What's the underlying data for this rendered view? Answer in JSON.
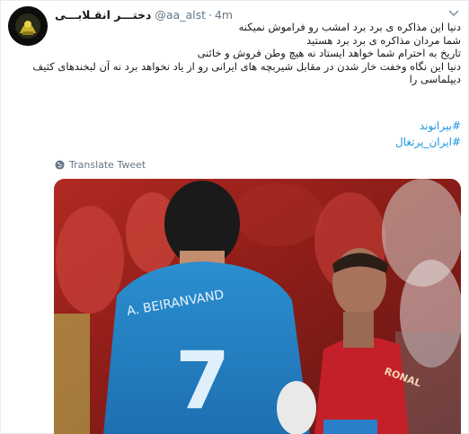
{
  "tweet": {
    "display_name": "دختـــر انقـلابـــی",
    "handle": "@aa_alst",
    "separator": "·",
    "timestamp": "4m",
    "lines": [
      "دنیا این مذاکره ی برد برد امشب رو فراموش نمیکنه",
      "شما مردان مذاکره ی برد برد هستید",
      "تاریخ به احترام شما خواهد ایستاد نه هیچ وطن فروش و خائنی",
      "دنیا این نگاه وخفت خار شدن در مقابل شیربچه های ایرانی رو از یاد نخواهد برد نه آن لبخندهای کثیف",
      "دیپلماسی را"
    ],
    "hashtags": [
      "#بیرانوند",
      "#ایران_پرتغال"
    ],
    "translate_label": "Translate Tweet"
  },
  "media": {
    "jersey_back_text": "A. BEIRANVAND",
    "jersey_number": "7",
    "player2_jersey_text": "RONAL"
  },
  "icons": {
    "options": "chevron-down-icon",
    "translate": "globe-icon"
  },
  "colors": {
    "link": "#1b95e0",
    "secondary_text": "#657786",
    "border": "#e6ecf0"
  }
}
